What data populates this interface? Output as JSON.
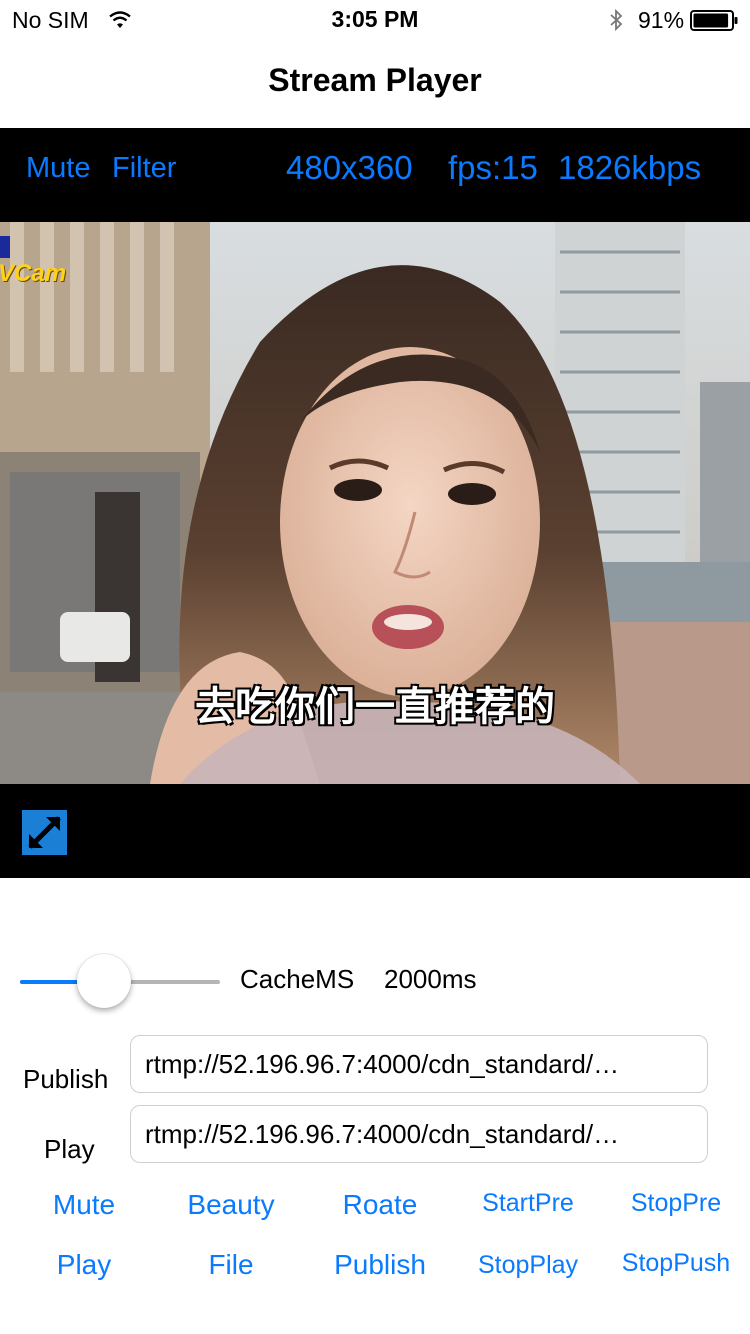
{
  "status_bar": {
    "carrier": "No SIM",
    "time": "3:05 PM",
    "battery": "91%",
    "battery_level": 0.91
  },
  "nav": {
    "title": "Stream Player"
  },
  "info_bar": {
    "mute_label": "Mute",
    "filter_label": "Filter",
    "resolution": "480x360",
    "fps": "fps:15",
    "bitrate": "1826kbps"
  },
  "video": {
    "watermark": "VCam",
    "subtitle": "去吃你们一直推荐的"
  },
  "cache": {
    "label": "CacheMS",
    "value": "2000ms",
    "slider_fraction": 0.4
  },
  "publish": {
    "label": "Publish",
    "url": "rtmp://52.196.96.7:4000/cdn_standard/…"
  },
  "play": {
    "label": "Play",
    "url": "rtmp://52.196.96.7:4000/cdn_standard/…"
  },
  "actions_row1": [
    "Mute",
    "Beauty",
    "Roate",
    "StartPre",
    "StopPre"
  ],
  "actions_row2": [
    "Play",
    "File",
    "Publish",
    "StopPlay",
    "StopPush"
  ],
  "colors": {
    "accent": "#0a7aff",
    "bar_bg": "#000000",
    "fullscreen_btn": "#1c7fd6"
  }
}
